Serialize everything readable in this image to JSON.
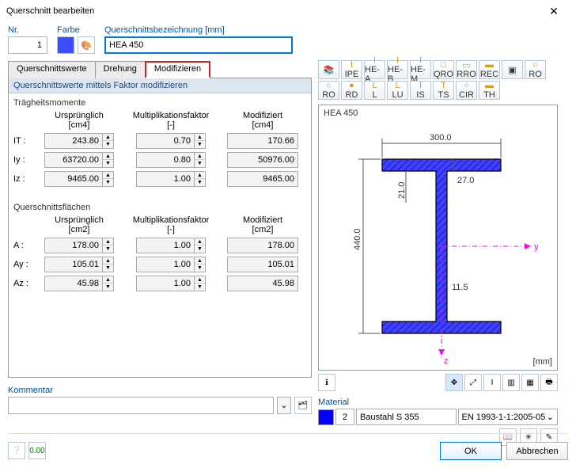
{
  "window": {
    "title": "Querschnitt bearbeiten"
  },
  "top": {
    "nr_label": "Nr.",
    "nr_value": "1",
    "farbe_label": "Farbe",
    "qb_label": "Querschnittsbezeichnung [mm]",
    "qb_value": "HEA 450"
  },
  "tabs": {
    "t1": "Querschnittswerte",
    "t2": "Drehung",
    "t3": "Modifizieren"
  },
  "section": {
    "header": "Querschnittswerte mittels Faktor modifizieren"
  },
  "inert": {
    "title": "Trägheitsmomente",
    "h1": "Ursprünglich",
    "u1": "[cm4]",
    "h2": "Multiplikationsfaktor",
    "u2": "[-]",
    "h3": "Modifiziert",
    "u3": "[cm4]",
    "r1": {
      "lbl": "IT :",
      "orig": "243.80",
      "fac": "0.70",
      "mod": "170.66"
    },
    "r2": {
      "lbl": "Iy :",
      "orig": "63720.00",
      "fac": "0.80",
      "mod": "50976.00"
    },
    "r3": {
      "lbl": "Iz :",
      "orig": "9465.00",
      "fac": "1.00",
      "mod": "9465.00"
    }
  },
  "areas": {
    "title": "Querschnittsflächen",
    "h1": "Ursprünglich",
    "u1": "[cm2]",
    "h2": "Multiplikationsfaktor",
    "u2": "[-]",
    "h3": "Modifiziert",
    "u3": "[cm2]",
    "r1": {
      "lbl": "A :",
      "orig": "178.00",
      "fac": "1.00",
      "mod": "178.00"
    },
    "r2": {
      "lbl": "Ay :",
      "orig": "105.01",
      "fac": "1.00",
      "mod": "105.01"
    },
    "r3": {
      "lbl": "Az :",
      "orig": "45.98",
      "fac": "1.00",
      "mod": "45.98"
    }
  },
  "kommentar": {
    "label": "Kommentar",
    "value": ""
  },
  "toolbar1": [
    "",
    "IPE",
    "HE-A",
    "HE-B",
    "HE-M",
    "QRO",
    "RRO",
    "REC",
    ""
  ],
  "toolbar2": [
    "RO",
    "RO",
    "RD",
    "L",
    "LU",
    "IS",
    "TS",
    "CIR",
    "TH"
  ],
  "preview": {
    "title": "HEA 450",
    "unit": "[mm]",
    "dims": {
      "width": "300.0",
      "height": "440.0",
      "tw": "11.5",
      "tf": "27.0",
      "r": "21.0",
      "y": "y",
      "z": "z"
    }
  },
  "material": {
    "label": "Material",
    "nr": "2",
    "name": "Baustahl S 355",
    "norm": "EN 1993-1-1:2005-05"
  },
  "footer": {
    "ok": "OK",
    "cancel": "Abbrechen"
  }
}
